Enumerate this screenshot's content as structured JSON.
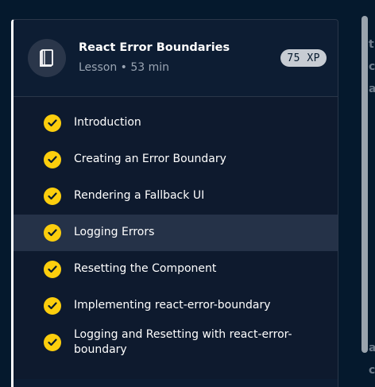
{
  "lesson": {
    "title": "React Error Boundaries",
    "subtitle": "Lesson • 53 min",
    "xp": "75 XP",
    "icon": "book-icon",
    "items": [
      {
        "label": "Introduction",
        "completed": true,
        "active": false
      },
      {
        "label": "Creating an Error Boundary",
        "completed": true,
        "active": false
      },
      {
        "label": "Rendering a Fallback UI",
        "completed": true,
        "active": false
      },
      {
        "label": "Logging Errors",
        "completed": true,
        "active": true
      },
      {
        "label": "Resetting the Component",
        "completed": true,
        "active": false
      },
      {
        "label": "Implementing react-error-boundary",
        "completed": true,
        "active": false
      },
      {
        "label": "Logging and Resetting with react-error-boundary",
        "completed": true,
        "active": false
      }
    ]
  },
  "colors": {
    "background": "#05192d",
    "card": "#0e1a2e",
    "active_row": "#253248",
    "check": "#fcce0d"
  }
}
